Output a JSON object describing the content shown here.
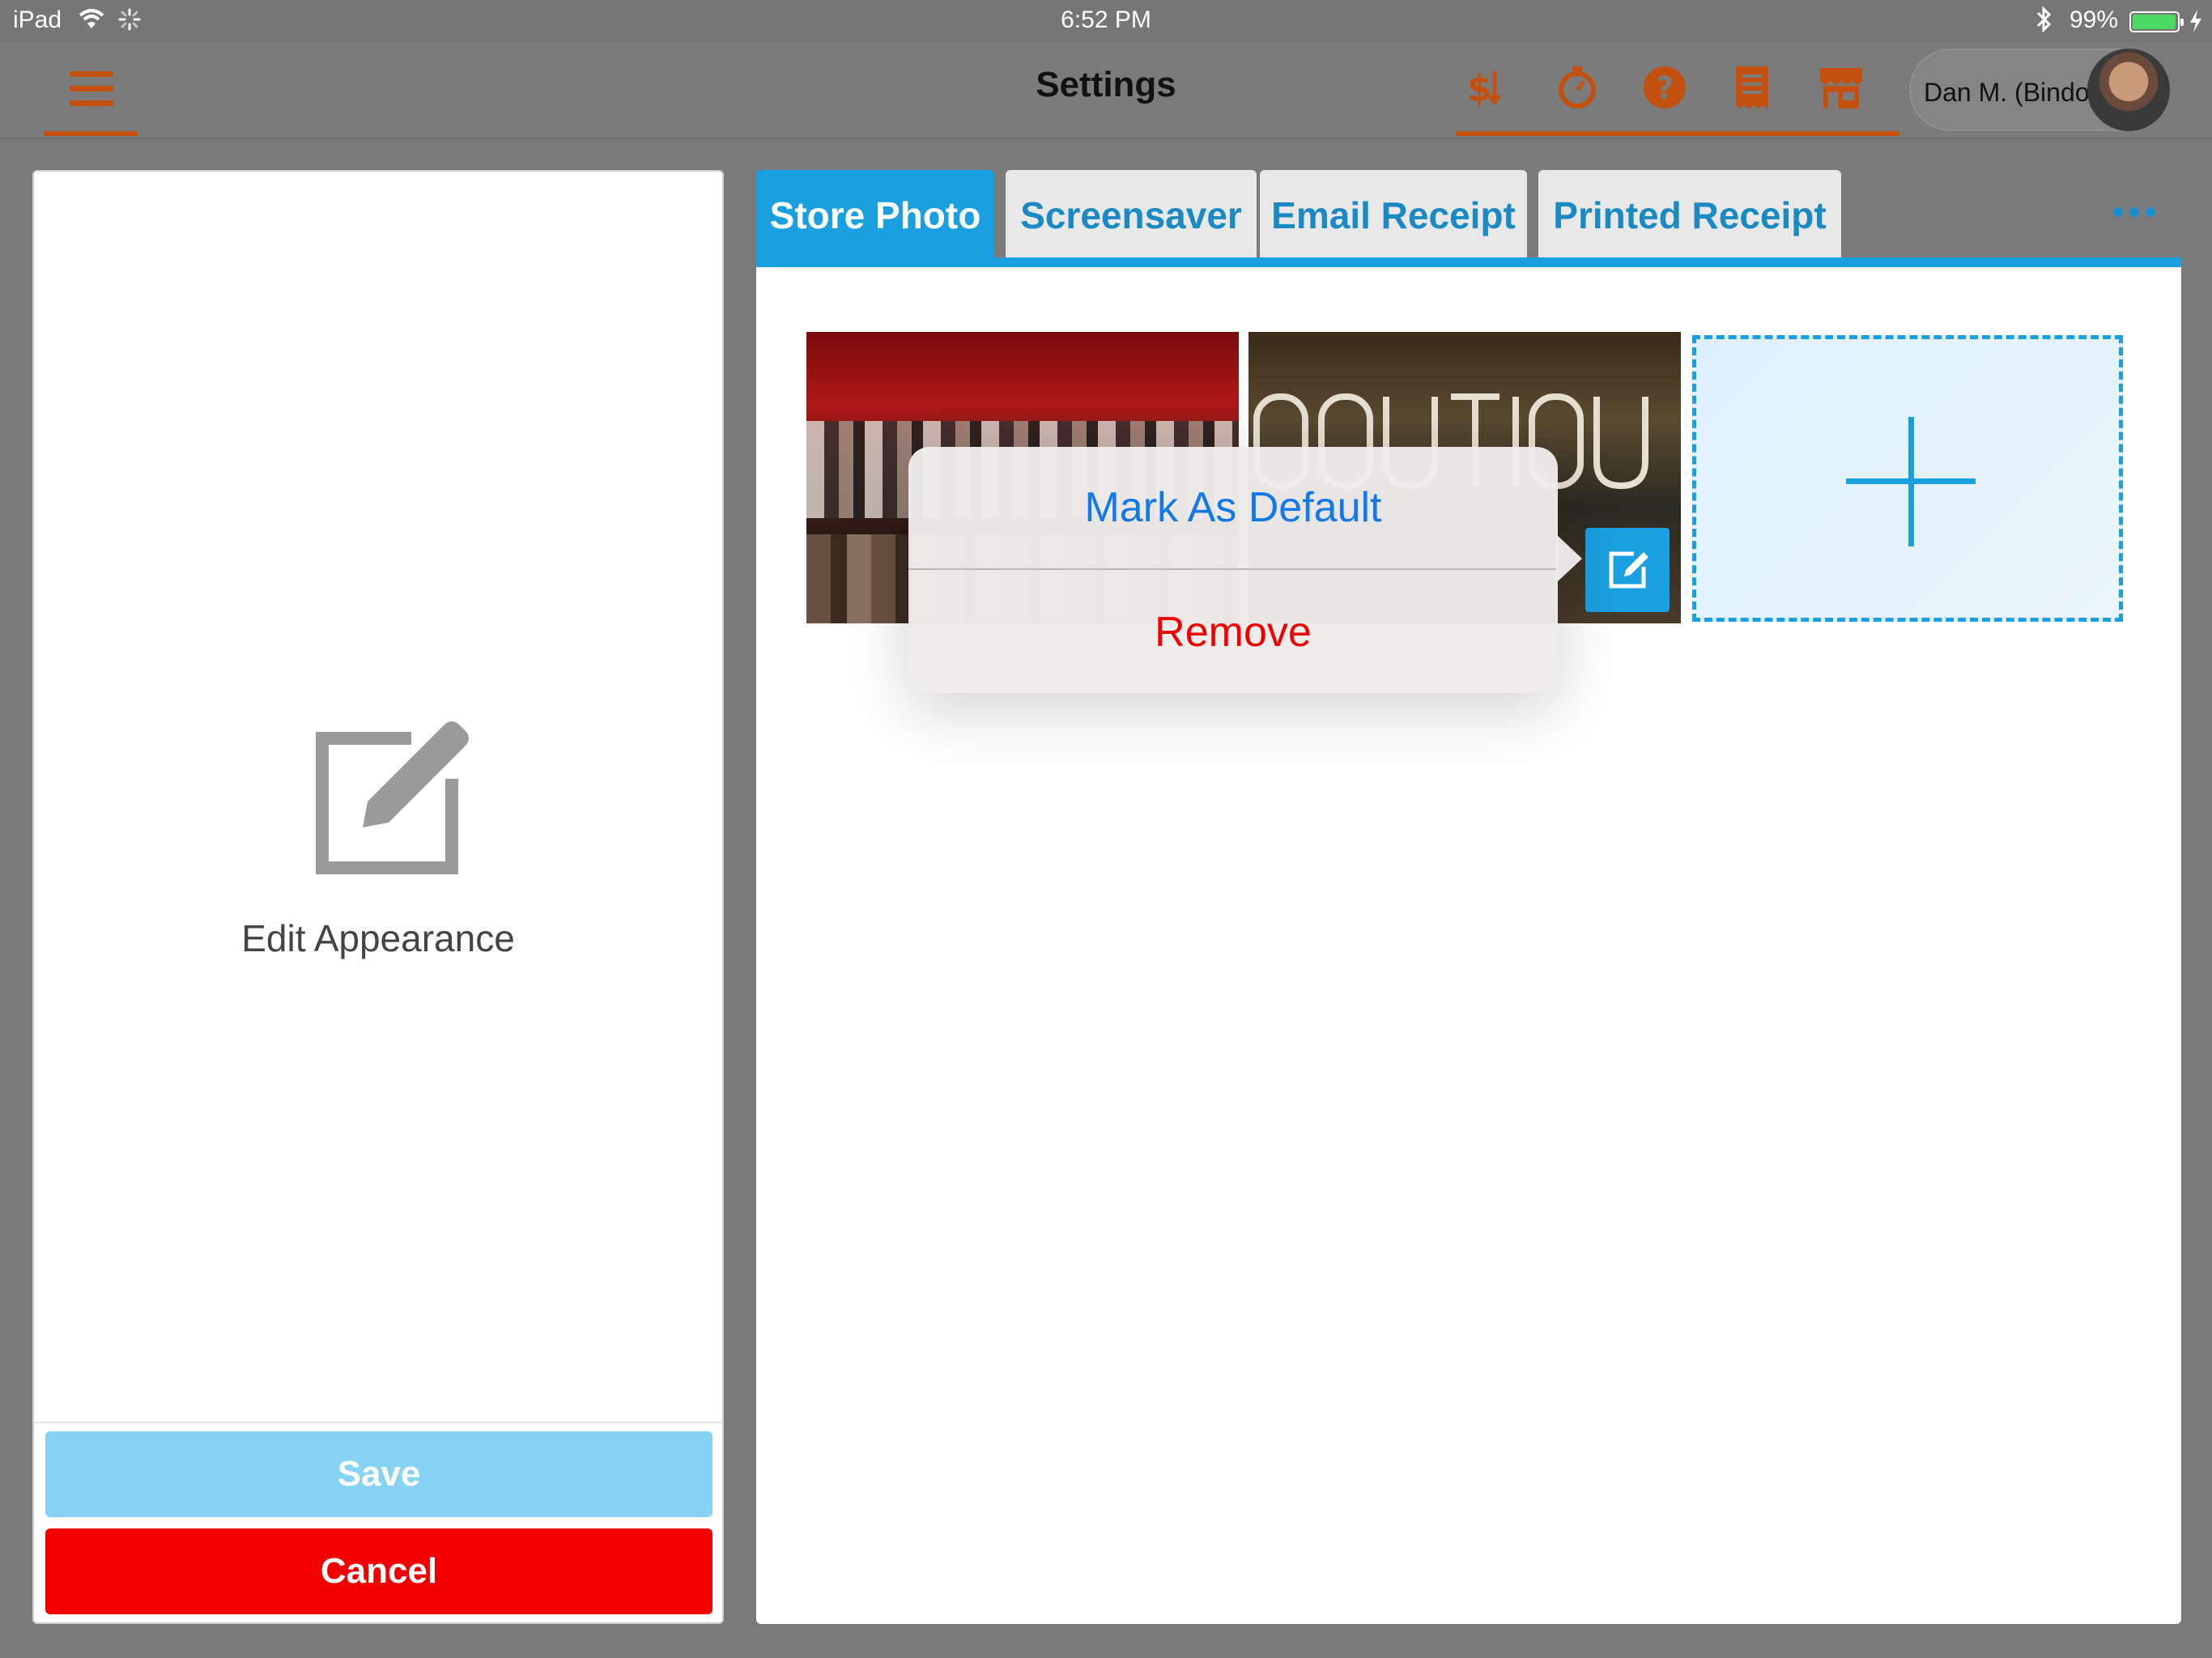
{
  "status_bar": {
    "device": "iPad",
    "time": "6:52 PM",
    "battery_percent": "99%",
    "battery_level": 0.99,
    "icons": [
      "wifi-icon",
      "activity-spinner-icon",
      "bluetooth-icon",
      "battery-icon",
      "charging-icon"
    ]
  },
  "nav": {
    "title": "Settings",
    "user_name": "Dan M. (Bindo)",
    "accent_color": "#c4500f",
    "icons": [
      "menu-icon",
      "price-sort-icon",
      "timer-icon",
      "help-icon",
      "receipt-icon",
      "store-icon"
    ]
  },
  "left_panel": {
    "edit_label": "Edit Appearance",
    "save_label": "Save",
    "cancel_label": "Cancel",
    "save_color": "#87d3f3",
    "cancel_color": "#f20000"
  },
  "tabs": [
    {
      "label": "Store Photo",
      "active": true
    },
    {
      "label": "Screensaver",
      "active": false
    },
    {
      "label": "Email Receipt",
      "active": false
    },
    {
      "label": "Printed Receipt",
      "active": false
    }
  ],
  "popover": {
    "mark_default_label": "Mark As Default",
    "remove_label": "Remove"
  },
  "colors": {
    "primary": "#1a9fe0",
    "link": "#1479e8",
    "destructive": "#f00000"
  }
}
